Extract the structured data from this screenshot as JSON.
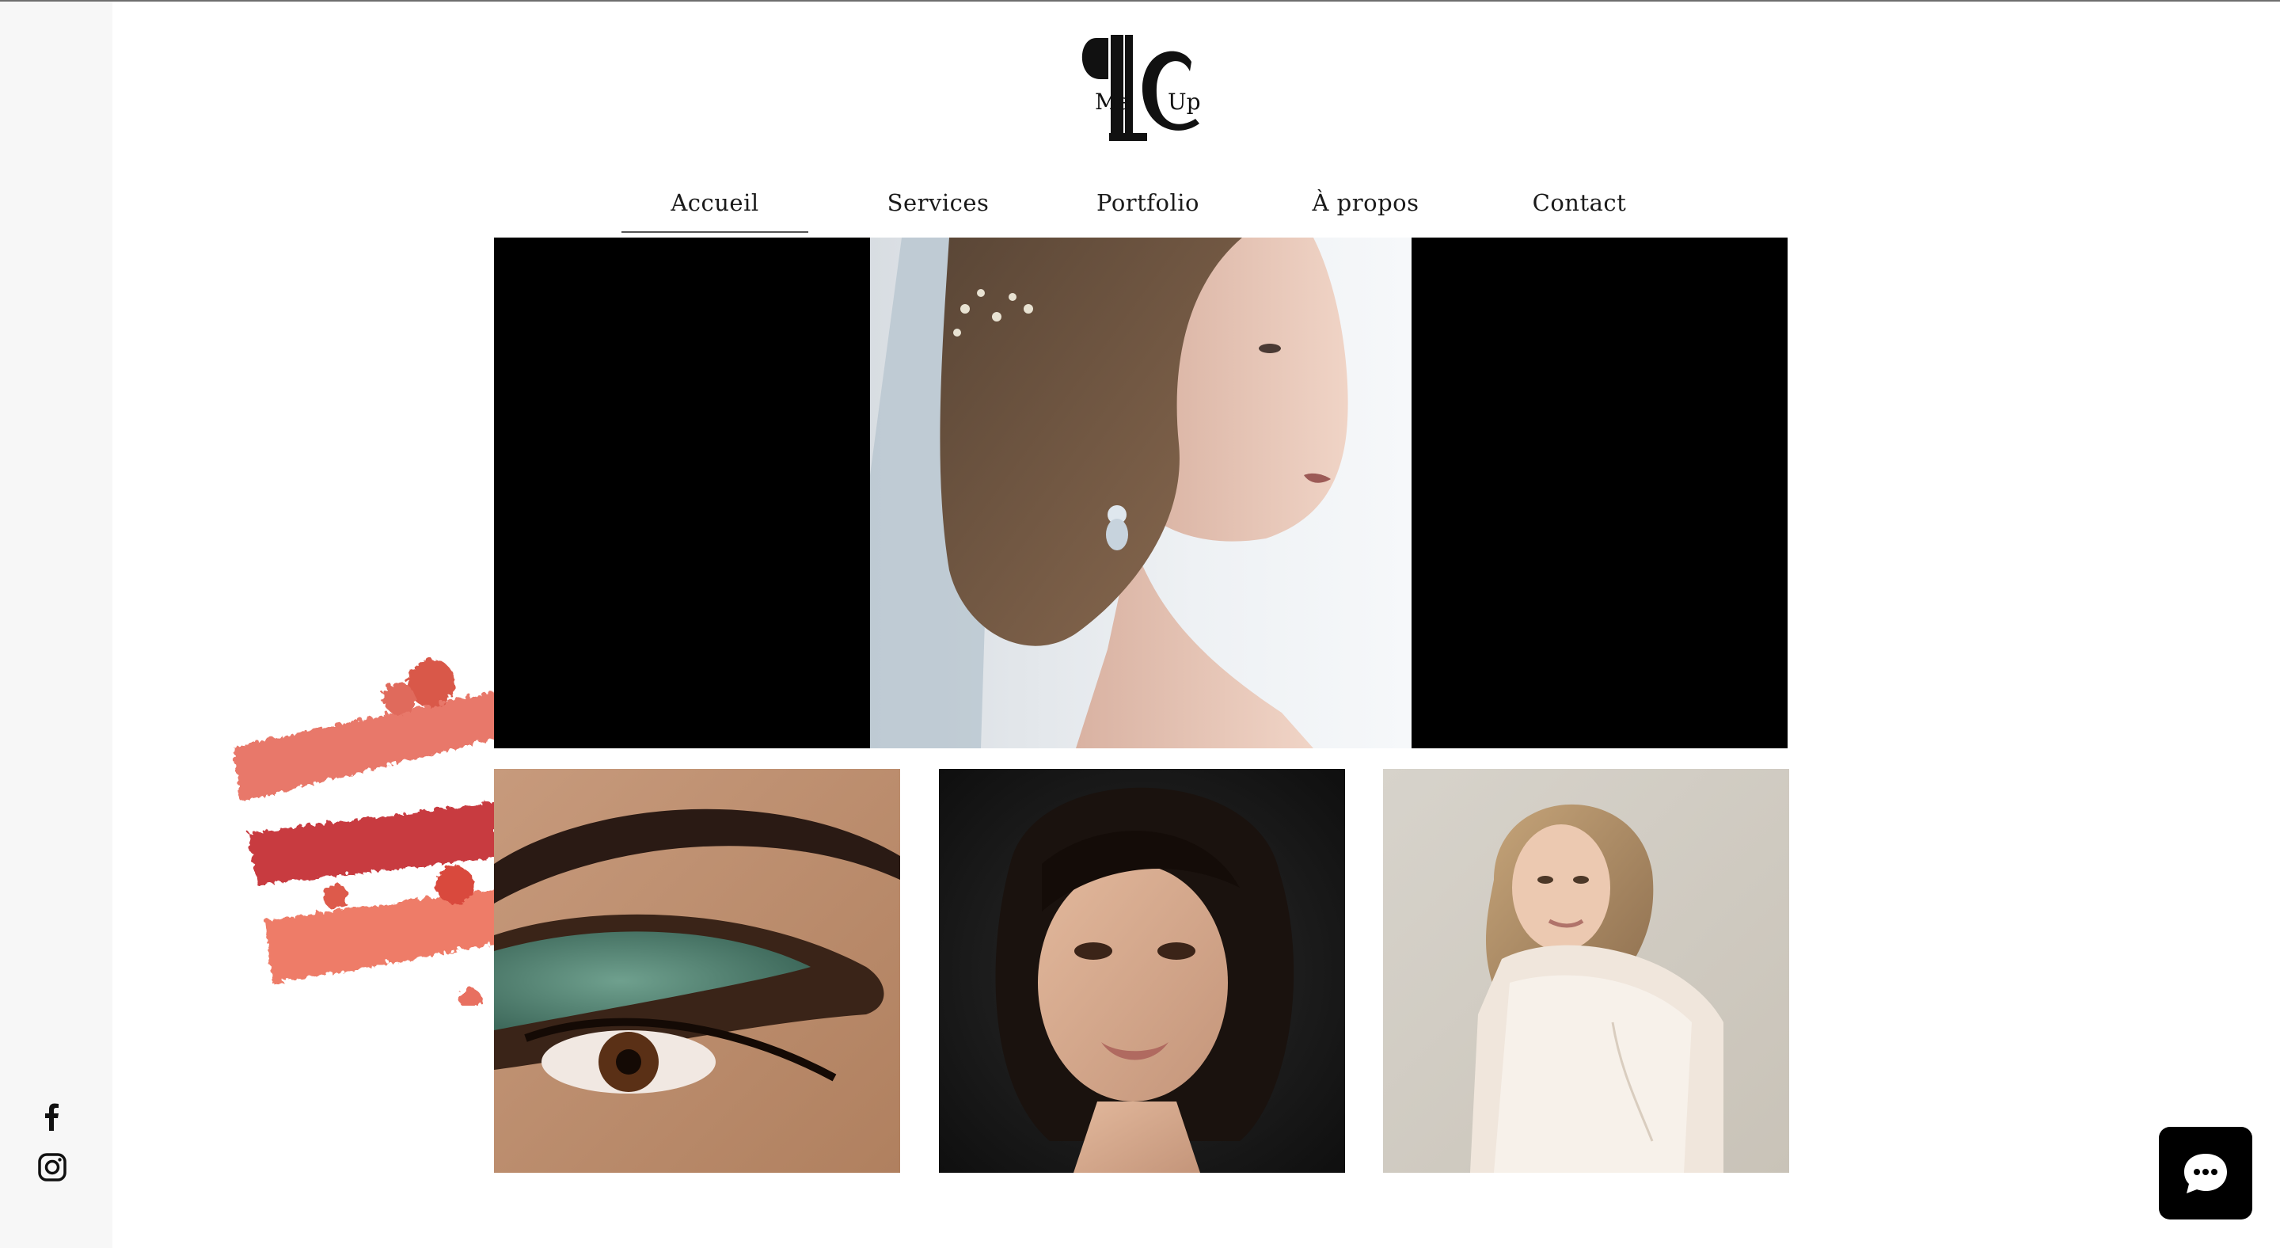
{
  "brand": {
    "logo_letters": "PC",
    "logo_text": "MakeUp"
  },
  "nav": {
    "items": [
      {
        "label": "Accueil",
        "active": true
      },
      {
        "label": "Services",
        "active": false
      },
      {
        "label": "Portfolio",
        "active": false
      },
      {
        "label": "À propos",
        "active": false
      },
      {
        "label": "Contact",
        "active": false
      }
    ]
  },
  "hero": {
    "image": "bride-profile-photo",
    "background_color": "#000000"
  },
  "gallery": [
    {
      "image": "green-eyeshadow-closeup-photo"
    },
    {
      "image": "dark-hair-portrait-photo"
    },
    {
      "image": "bride-smiling-photo"
    }
  ],
  "decoration": {
    "image": "red-lipstick-swatches"
  },
  "social": [
    {
      "icon": "facebook-icon"
    },
    {
      "icon": "instagram-icon"
    }
  ],
  "chat": {
    "icon": "chat-icon"
  },
  "colors": {
    "background": "#ffffff",
    "left_strip": "#f7f7f7",
    "text": "#1a1a1a",
    "hero_bg": "#000000",
    "accent_red": "#d9534a"
  }
}
